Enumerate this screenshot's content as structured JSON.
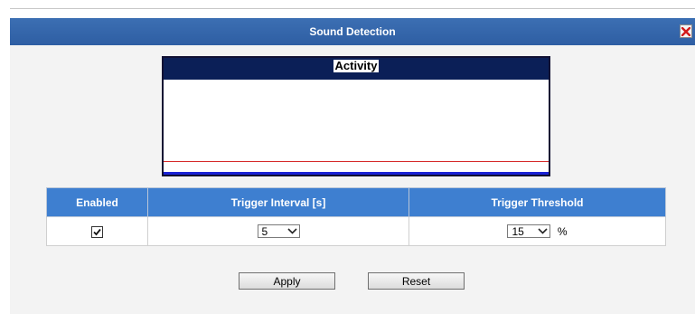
{
  "dialog": {
    "title": "Sound Detection",
    "close_icon": "close-icon"
  },
  "activity": {
    "title": "Activity",
    "colors": {
      "header": "#0b1f57",
      "threshold_line": "#d62a2a",
      "level_bar": "#1a22d6"
    }
  },
  "settings": {
    "headers": {
      "enabled": "Enabled",
      "interval": "Trigger Interval [s]",
      "threshold": "Trigger Threshold"
    },
    "enabled_checked": true,
    "interval_value": "5",
    "threshold_value": "15",
    "threshold_unit": "%"
  },
  "buttons": {
    "apply": "Apply",
    "reset": "Reset"
  },
  "colors": {
    "titlebar": "#2e5ea3",
    "table_header": "#3e7fd0"
  }
}
